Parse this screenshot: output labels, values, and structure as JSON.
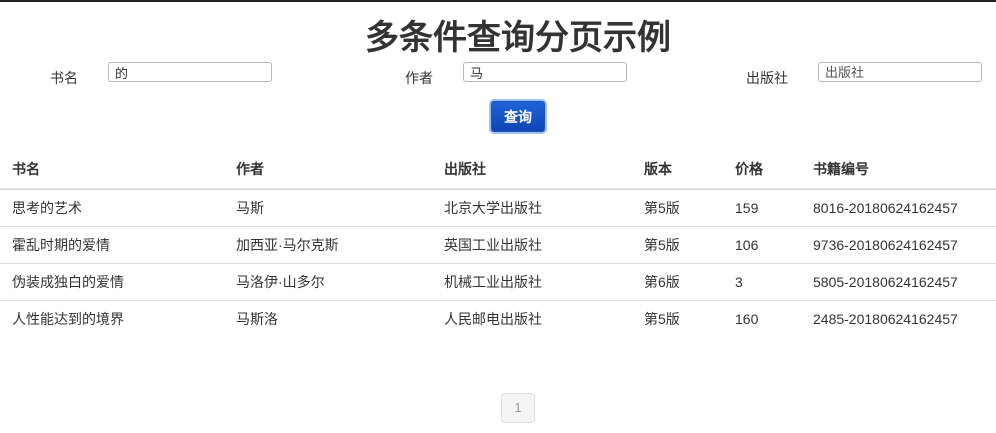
{
  "page": {
    "title": "多条件查询分页示例"
  },
  "search": {
    "book_label": "书名",
    "book_value": "的",
    "author_label": "作者",
    "author_value": "马",
    "publisher_label": "出版社",
    "publisher_value": "",
    "publisher_placeholder": "出版社",
    "query_label": "查询"
  },
  "table": {
    "headers": [
      "书名",
      "作者",
      "出版社",
      "版本",
      "价格",
      "书籍编号"
    ],
    "rows": [
      [
        "思考的艺术",
        "马斯",
        "北京大学出版社",
        "第5版",
        "159",
        "8016-20180624162457"
      ],
      [
        "霍乱时期的爱情",
        "加西亚·马尔克斯",
        "英国工业出版社",
        "第5版",
        "106",
        "9736-20180624162457"
      ],
      [
        "伪装成独白的爱情",
        "马洛伊·山多尔",
        "机械工业出版社",
        "第6版",
        "3",
        "5805-20180624162457"
      ],
      [
        "人性能达到的境界",
        "马斯洛",
        "人民邮电出版社",
        "第5版",
        "160",
        "2485-20180624162457"
      ]
    ]
  },
  "pagination": {
    "current": "1"
  },
  "colors": {
    "accent": "#0f46b3",
    "border": "#dddddd"
  }
}
